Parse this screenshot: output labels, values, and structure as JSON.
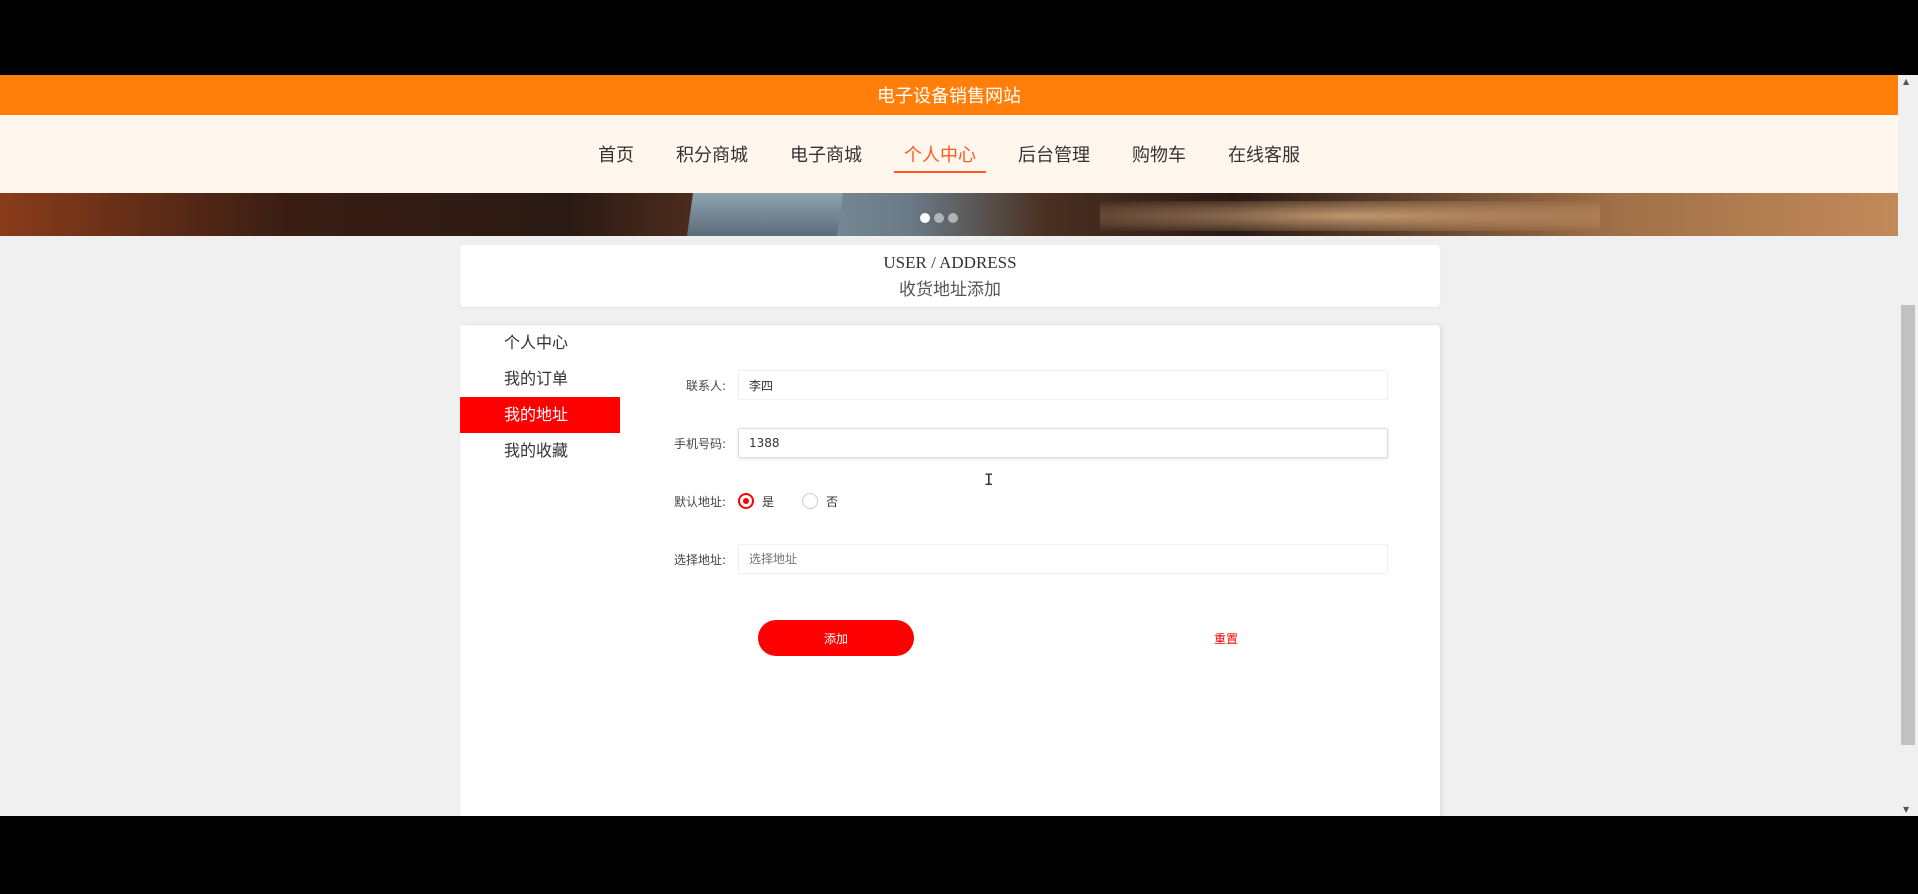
{
  "site_title": "电子设备销售网站",
  "nav": {
    "items": [
      {
        "label": "首页"
      },
      {
        "label": "积分商城"
      },
      {
        "label": "电子商城"
      },
      {
        "label": "个人中心"
      },
      {
        "label": "后台管理"
      },
      {
        "label": "购物车"
      },
      {
        "label": "在线客服"
      }
    ],
    "active": "个人中心"
  },
  "page_header": {
    "title_en": "USER / ADDRESS",
    "title_cn": "收货地址添加"
  },
  "side_menu": {
    "items": [
      {
        "label": "个人中心"
      },
      {
        "label": "我的订单"
      },
      {
        "label": "我的地址"
      },
      {
        "label": "我的收藏"
      }
    ],
    "active": "我的地址"
  },
  "form": {
    "contact": {
      "label": "联系人:",
      "value": "李四"
    },
    "phone": {
      "label": "手机号码:",
      "value": "1388"
    },
    "default_address": {
      "label": "默认地址:",
      "options": [
        {
          "label": "是",
          "checked": true
        },
        {
          "label": "否",
          "checked": false
        }
      ]
    },
    "select_address": {
      "label": "选择地址:",
      "placeholder": "选择地址"
    },
    "add_button": "添加",
    "reset_button": "重置"
  },
  "colors": {
    "topbar": "#ff7f0a",
    "nav_bg": "#fff6ee",
    "accent": "#ff0000",
    "nav_active": "#ff5a1f"
  }
}
